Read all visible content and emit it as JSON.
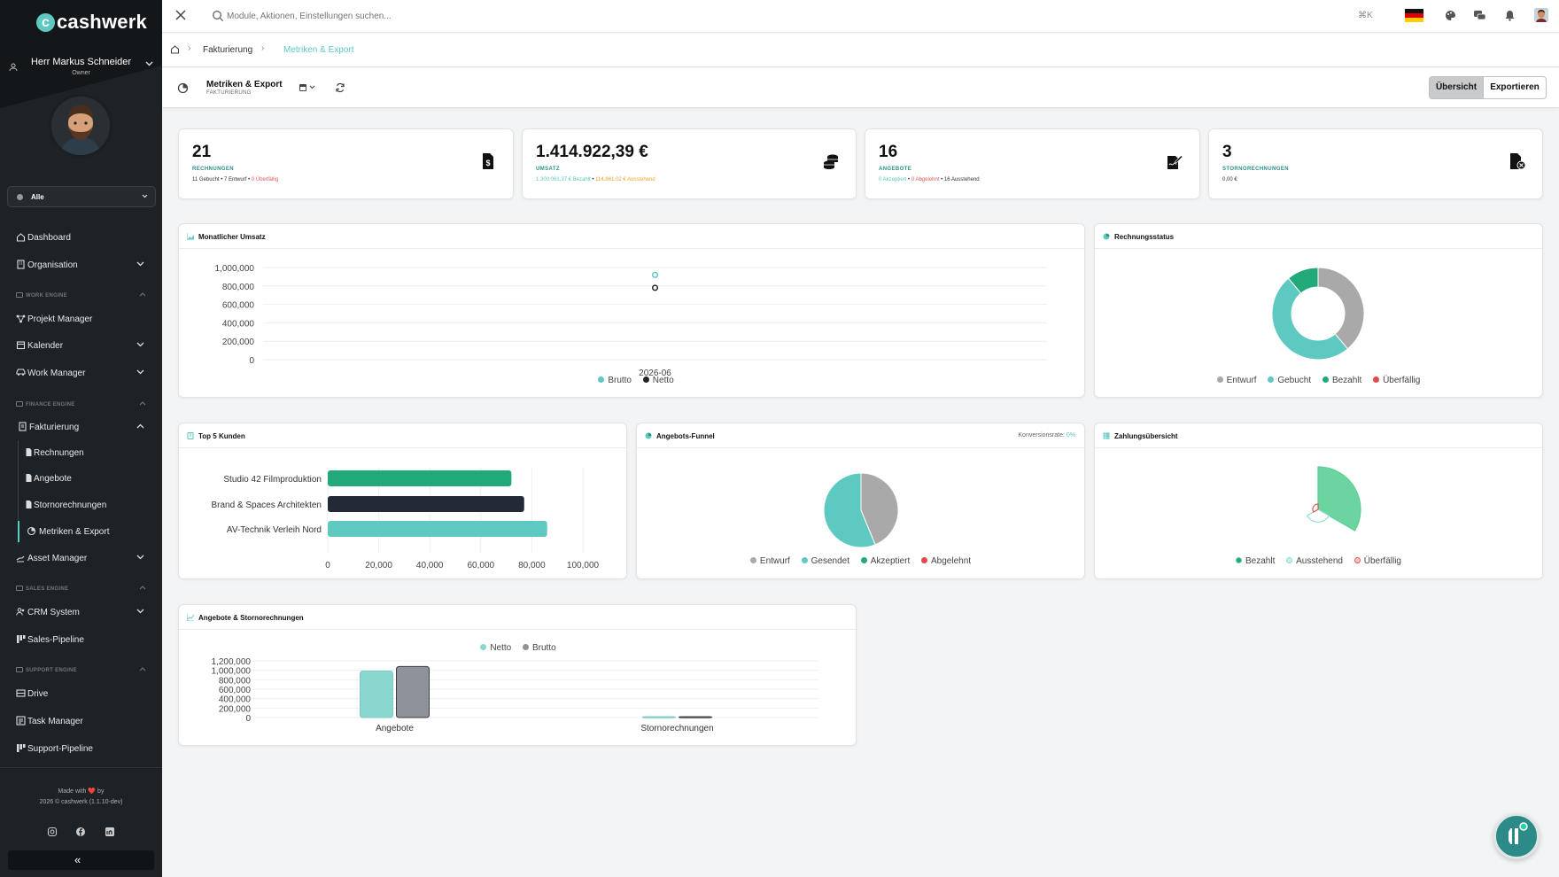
{
  "app": {
    "brand": "cashwerk"
  },
  "user": {
    "name": "Herr Markus Schneider",
    "role": "Owner"
  },
  "scope": {
    "selected": "Alle"
  },
  "sidebar": {
    "items": [
      {
        "label": "Dashboard",
        "icon": "home-icon"
      },
      {
        "label": "Organisation",
        "icon": "building-icon"
      },
      {
        "section": "WORK ENGINE"
      },
      {
        "label": "Projekt Manager",
        "icon": "network-icon"
      },
      {
        "label": "Kalender",
        "icon": "calendar-icon"
      },
      {
        "label": "Work Manager",
        "icon": "car-icon"
      },
      {
        "section": "FINANCE ENGINE"
      },
      {
        "label": "Fakturierung",
        "icon": "invoice-icon"
      },
      {
        "label": "Rechnungen",
        "icon": "file-icon"
      },
      {
        "label": "Angebote",
        "icon": "file-icon"
      },
      {
        "label": "Stornorechnungen",
        "icon": "file-icon"
      },
      {
        "label": "Metriken & Export",
        "icon": "pie-chart-icon"
      },
      {
        "label": "Asset Manager",
        "icon": "hand-icon"
      },
      {
        "section": "SALES ENGINE"
      },
      {
        "label": "CRM System",
        "icon": "users-icon"
      },
      {
        "label": "Sales-Pipeline",
        "icon": "pipeline-icon"
      },
      {
        "section": "SUPPORT ENGINE"
      },
      {
        "label": "Drive",
        "icon": "drive-icon"
      },
      {
        "label": "Task Manager",
        "icon": "tasks-icon"
      },
      {
        "label": "Support-Pipeline",
        "icon": "pipeline-icon"
      }
    ],
    "footer": {
      "made_with": "Made with ❤️ by",
      "copyright": "2026 © cashwerk (1.1.10-dev)"
    }
  },
  "topbar": {
    "search_placeholder": "Module, Aktionen, Einstellungen suchen...",
    "shortcut": "⌘K"
  },
  "breadcrumb": {
    "items": [
      "Fakturierung",
      "Metriken & Export"
    ]
  },
  "page": {
    "title": "Metriken & Export",
    "subtitle": "FAKTURIERUNG",
    "tabs": [
      "Übersicht",
      "Exportieren"
    ],
    "active_tab": "Übersicht"
  },
  "kpis": [
    {
      "value": "21",
      "label": "RECHNUNGEN",
      "parts": [
        {
          "text": "11 Gebucht",
          "color": "#333"
        },
        {
          "text": "7 Entwurf",
          "color": "#333"
        },
        {
          "text": "0 Überfällig",
          "color": "#e05a5a"
        }
      ],
      "icon": "invoice-dollar-icon"
    },
    {
      "value": "1.414.922,39 €",
      "label": "UMSATZ",
      "parts": [
        {
          "text": "1.300.061,37 € Bezahlt",
          "color": "#5ec9c1"
        },
        {
          "text": "114.861,02 € Ausstehend",
          "color": "#f0a030"
        }
      ],
      "icon": "coins-icon"
    },
    {
      "value": "16",
      "label": "ANGEBOTE",
      "parts": [
        {
          "text": "0 Akzeptiert",
          "color": "#5ec9c1"
        },
        {
          "text": "0 Abgelehnt",
          "color": "#e05a5a"
        },
        {
          "text": "16 Ausstehend",
          "color": "#333"
        }
      ],
      "icon": "signature-icon"
    },
    {
      "value": "3",
      "label": "STORNORECHNUNGEN",
      "parts": [
        {
          "text": "0,00 €",
          "color": "#333"
        }
      ],
      "icon": "file-cancel-icon"
    }
  ],
  "panels": {
    "monthly": {
      "title": "Monatlicher Umsatz"
    },
    "status": {
      "title": "Rechnungsstatus"
    },
    "top5": {
      "title": "Top 5 Kunden"
    },
    "funnel": {
      "title": "Angebots-Funnel",
      "conv_label": "Konversionsrate:",
      "conv_value": "0%"
    },
    "payments": {
      "title": "Zahlungsübersicht"
    },
    "offers": {
      "title": "Angebote & Stornorechnungen"
    }
  },
  "chart_data": [
    {
      "type": "line",
      "title": "Monatlicher Umsatz",
      "x": [
        "2026-06"
      ],
      "series": [
        {
          "name": "Brutto",
          "values": [
            920000
          ],
          "color": "#5ec9c1"
        },
        {
          "name": "Netto",
          "values": [
            780000
          ],
          "color": "#222"
        }
      ],
      "yticks": [
        "0",
        "200,000",
        "400,000",
        "600,000",
        "800,000",
        "1,000,000"
      ],
      "ylim": [
        0,
        1000000
      ],
      "legend": "bottom"
    },
    {
      "type": "pie",
      "title": "Rechnungsstatus",
      "donut": true,
      "categories": [
        "Entwurf",
        "Gebucht",
        "Bezahlt",
        "Überfällig"
      ],
      "values": [
        7,
        9,
        2,
        0
      ],
      "colors": [
        "#a9a9a9",
        "#5ec9c1",
        "#22a97a",
        "#e04a4a"
      ],
      "legend": "bottom"
    },
    {
      "type": "bar",
      "orientation": "horizontal",
      "title": "Top 5 Kunden",
      "categories": [
        "Studio 42 Filmproduktion",
        "Brand & Spaces Architekten",
        "AV-Technik Verleih Nord"
      ],
      "values": [
        72000,
        77000,
        86000
      ],
      "colors": [
        "#22a97a",
        "#232a35",
        "#5ec9c1"
      ],
      "xticks": [
        "0",
        "20,000",
        "40,000",
        "60,000",
        "80,000",
        "100,000"
      ],
      "xlim": [
        0,
        100000
      ]
    },
    {
      "type": "pie",
      "title": "Angebots-Funnel",
      "categories": [
        "Entwurf",
        "Gesendet",
        "Akzeptiert",
        "Abgelehnt"
      ],
      "values": [
        7,
        9,
        0,
        0
      ],
      "colors": [
        "#a9a9a9",
        "#5ec9c1",
        "#22a97a",
        "#e04a4a"
      ],
      "legend": "bottom"
    },
    {
      "type": "pie",
      "title": "Zahlungsübersicht",
      "variant": "polar-area",
      "categories": [
        "Bezahlt",
        "Ausstehend",
        "Überfällig"
      ],
      "values": [
        1300061.37,
        114861.02,
        0
      ],
      "colors": [
        "#5ccf96",
        "#8fdcd4",
        "#e05a5a"
      ],
      "legend": "bottom"
    },
    {
      "type": "bar",
      "title": "Angebote & Stornorechnungen",
      "categories": [
        "Angebote",
        "Stornorechnungen"
      ],
      "series": [
        {
          "name": "Netto",
          "values": [
            985000,
            0
          ],
          "color": "#8ad7d0"
        },
        {
          "name": "Brutto",
          "values": [
            1080000,
            0
          ],
          "color": "#8f9298"
        }
      ],
      "yticks": [
        "0",
        "200,000",
        "400,000",
        "600,000",
        "800,000",
        "1,000,000",
        "1,200,000"
      ],
      "ylim": [
        0,
        1200000
      ],
      "legend": "top"
    }
  ]
}
